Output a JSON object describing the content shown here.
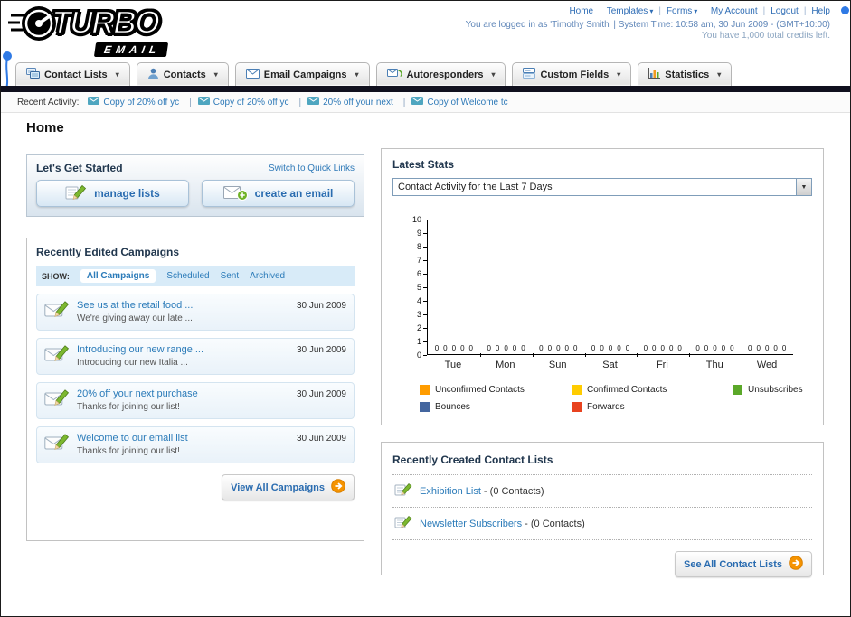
{
  "header": {
    "logo_primary": "TURBO",
    "logo_secondary": "EMAIL",
    "nav": [
      {
        "label": "Home"
      },
      {
        "label": "Templates"
      },
      {
        "label": "Forms"
      },
      {
        "label": "My Account"
      },
      {
        "label": "Logout"
      },
      {
        "label": "Help"
      }
    ],
    "session_line": "You are logged in as 'Timothy Smith' | System Time: 10:58 am, 30 Jun 2009 - (GMT+10:00)",
    "credits_line": "You have 1,000 total credits left."
  },
  "tabs": [
    {
      "label": "Contact Lists"
    },
    {
      "label": "Contacts"
    },
    {
      "label": "Email Campaigns"
    },
    {
      "label": "Autoresponders"
    },
    {
      "label": "Custom Fields"
    },
    {
      "label": "Statistics"
    }
  ],
  "recent_activity": {
    "label": "Recent Activity:",
    "items": [
      {
        "label": "Copy of 20% off yc"
      },
      {
        "label": "Copy of 20% off yc"
      },
      {
        "label": "20% off your next"
      },
      {
        "label": "Copy of Welcome tc"
      }
    ]
  },
  "page": {
    "title": "Home"
  },
  "get_started": {
    "title": "Let's Get Started",
    "switch_link": "Switch to Quick Links",
    "manage_lists_button": "manage lists",
    "create_email_button": "create an email"
  },
  "campaigns": {
    "title": "Recently Edited Campaigns",
    "show_label": "SHOW:",
    "filters": [
      {
        "label": "All Campaigns",
        "active": true
      },
      {
        "label": "Scheduled",
        "active": false
      },
      {
        "label": "Sent",
        "active": false
      },
      {
        "label": "Archived",
        "active": false
      }
    ],
    "items": [
      {
        "title": "See us at the retail food ...",
        "subtitle": "We're giving away our late ...",
        "date": "30 Jun 2009"
      },
      {
        "title": "Introducing our new range ...",
        "subtitle": "Introducing our new Italia ...",
        "date": "30 Jun 2009"
      },
      {
        "title": "20% off your next purchase",
        "subtitle": "Thanks for joining our list!",
        "date": "30 Jun 2009"
      },
      {
        "title": "Welcome to our email list",
        "subtitle": "Thanks for joining our list!",
        "date": "30 Jun 2009"
      }
    ],
    "view_all_button": "View All Campaigns"
  },
  "stats": {
    "title": "Latest Stats",
    "dropdown_value": "Contact Activity for the Last 7 Days",
    "chart_data": {
      "type": "bar",
      "title": "Contact Activity for the Last 7 Days",
      "categories": [
        "Tue",
        "Mon",
        "Sun",
        "Sat",
        "Fri",
        "Thu",
        "Wed"
      ],
      "series": [
        {
          "name": "Unconfirmed Contacts",
          "color": "#ff9c00",
          "values": [
            0,
            0,
            0,
            0,
            0,
            0,
            0
          ]
        },
        {
          "name": "Confirmed Contacts",
          "color": "#ffcc00",
          "values": [
            0,
            0,
            0,
            0,
            0,
            0,
            0
          ]
        },
        {
          "name": "Unsubscribes",
          "color": "#5ba829",
          "values": [
            0,
            0,
            0,
            0,
            0,
            0,
            0
          ]
        },
        {
          "name": "Bounces",
          "color": "#44669f",
          "values": [
            0,
            0,
            0,
            0,
            0,
            0,
            0
          ]
        },
        {
          "name": "Forwards",
          "color": "#e8431f",
          "values": [
            0,
            0,
            0,
            0,
            0,
            0,
            0
          ]
        }
      ],
      "ylim": [
        0,
        10
      ],
      "grid": false,
      "legend_position": "bottom"
    }
  },
  "contact_lists": {
    "title": "Recently Created Contact Lists",
    "items": [
      {
        "name": "Exhibition List",
        "suffix": " - (0 Contacts)"
      },
      {
        "name": "Newsletter Subscribers",
        "suffix": " - (0 Contacts)"
      }
    ],
    "see_all_button": "See All Contact Lists"
  }
}
